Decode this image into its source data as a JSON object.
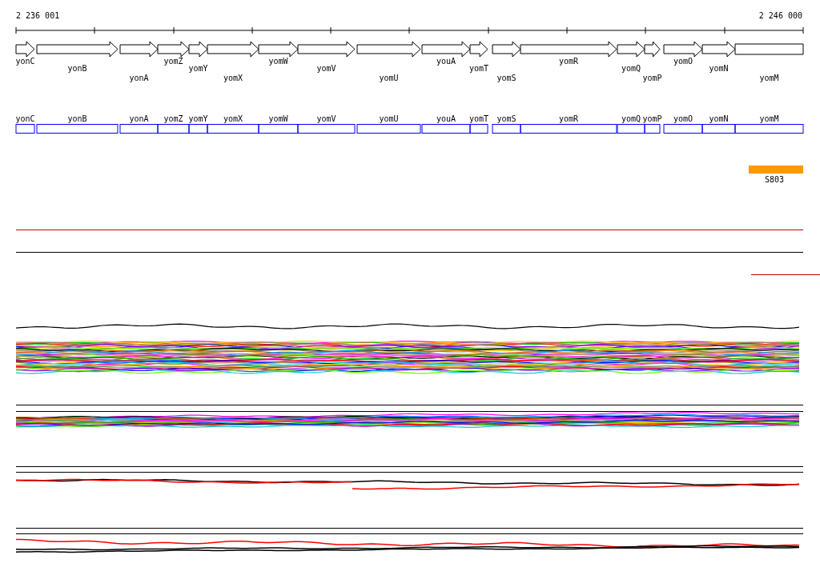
{
  "ruler": {
    "start_label": "2 236 001",
    "end_label": "2 246 000"
  },
  "genes": [
    {
      "name": "yonC",
      "truncated": false
    },
    {
      "name": "yonB",
      "truncated": false
    },
    {
      "name": "yonA",
      "truncated": false
    },
    {
      "name": "yomZ",
      "truncated": false
    },
    {
      "name": "yomY",
      "truncated": false
    },
    {
      "name": "yomX",
      "truncated": false
    },
    {
      "name": "yomW",
      "truncated": false
    },
    {
      "name": "yomV",
      "truncated": false
    },
    {
      "name": "yomU",
      "truncated": false
    },
    {
      "name": "youA",
      "truncated": false
    },
    {
      "name": "yomT",
      "truncated": false
    },
    {
      "name": "yomS",
      "truncated": false
    },
    {
      "name": "yomR",
      "truncated": false
    },
    {
      "name": "yomQ",
      "truncated": false
    },
    {
      "name": "yomP",
      "truncated": false
    },
    {
      "name": "yomO",
      "truncated": false
    },
    {
      "name": "yomN",
      "truncated": false
    },
    {
      "name": "yomM",
      "truncated": true
    }
  ],
  "gene_boxes": [
    {
      "name": "yonC"
    },
    {
      "name": "yonB"
    },
    {
      "name": "yonA"
    },
    {
      "name": "yomZ"
    },
    {
      "name": "yomY"
    },
    {
      "name": "yomX"
    },
    {
      "name": "yomW"
    },
    {
      "name": "yomV"
    },
    {
      "name": "yomU"
    },
    {
      "name": "youA"
    },
    {
      "name": "yomT"
    },
    {
      "name": "yomS"
    },
    {
      "name": "yomR"
    },
    {
      "name": "yomQ"
    },
    {
      "name": "yomP"
    },
    {
      "name": "yomO"
    },
    {
      "name": "yomN"
    },
    {
      "name": "yomM"
    }
  ],
  "features": [
    {
      "label": "S803",
      "color": "#ff9900"
    }
  ]
}
